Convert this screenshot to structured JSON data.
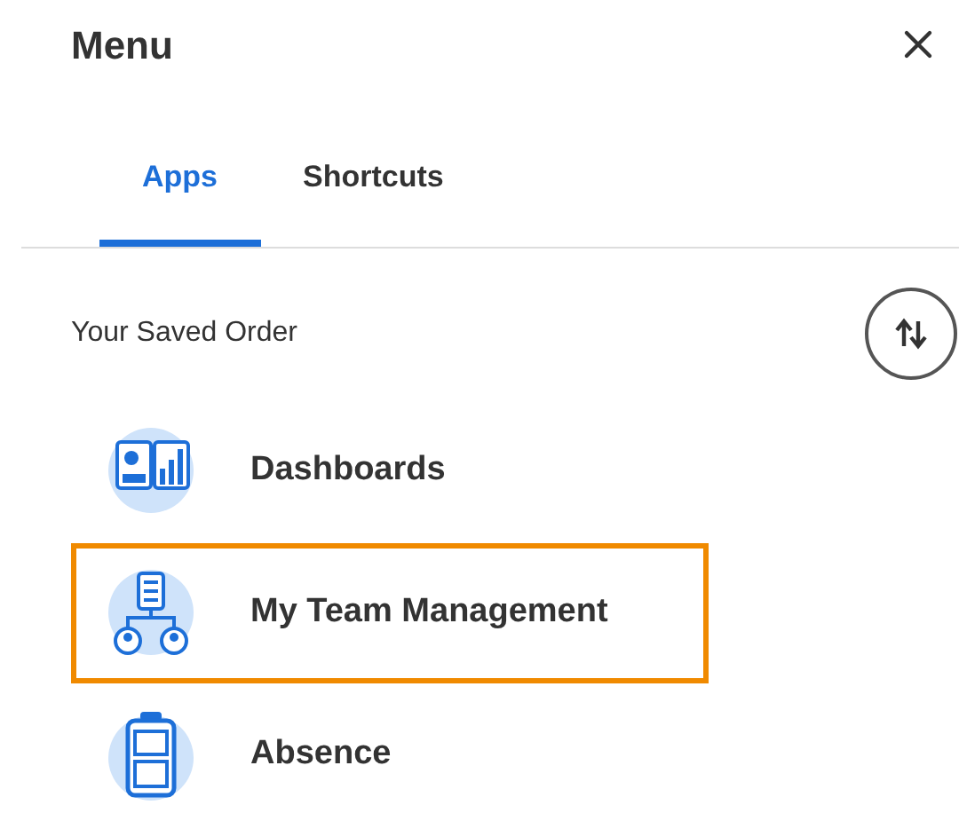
{
  "header": {
    "title": "Menu"
  },
  "tabs": [
    {
      "label": "Apps",
      "selected": true
    },
    {
      "label": "Shortcuts",
      "selected": false
    }
  ],
  "section": {
    "label": "Your Saved Order"
  },
  "apps": [
    {
      "kind": "dashboards",
      "label": "Dashboards",
      "highlighted": false
    },
    {
      "kind": "team",
      "label": "My Team Management",
      "highlighted": true
    },
    {
      "kind": "absence",
      "label": "Absence",
      "highlighted": false
    }
  ]
}
